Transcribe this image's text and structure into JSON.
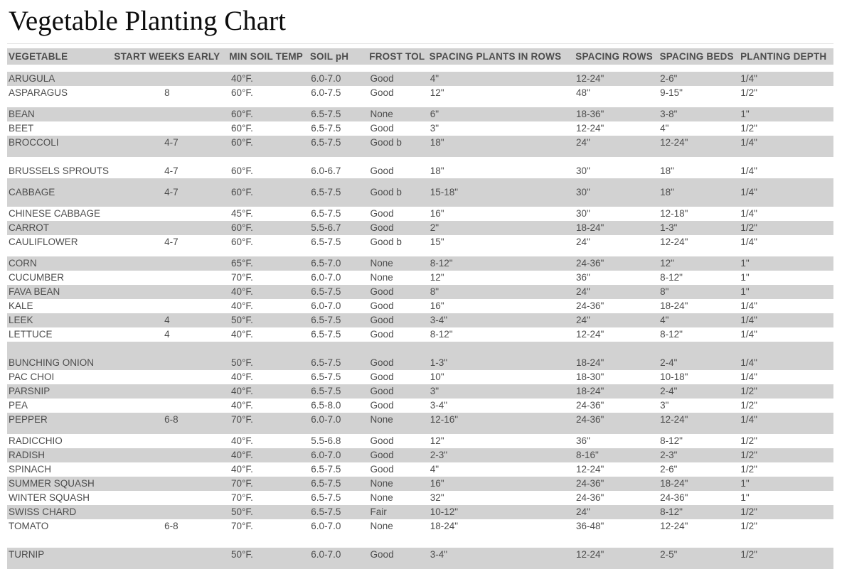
{
  "page_title": "Vegetable Planting Chart",
  "table": {
    "columns": [
      "VEGETABLE",
      "START WEEKS EARLY",
      "MIN SOIL TEMP",
      "SOIL pH",
      "FROST TOL",
      "SPACING PLANTS IN ROWS",
      "SPACING ROWS",
      "SPACING BEDS",
      "PLANTING DEPTH"
    ],
    "rows": [
      {
        "vegetable": "ARUGULA",
        "start_weeks_early": "",
        "min_soil_temp": "40°F.",
        "soil_ph": "6.0-7.0",
        "frost_tol": "Good",
        "spacing_plants_in_rows": "4\"",
        "spacing_rows": "12-24\"",
        "spacing_beds": "2-6\"",
        "planting_depth": "1/4\"",
        "shaded": true
      },
      {
        "vegetable": "ASPARAGUS",
        "start_weeks_early": "8",
        "min_soil_temp": "60°F.",
        "soil_ph": "6.0-7.5",
        "frost_tol": "Good",
        "spacing_plants_in_rows": "12\"",
        "spacing_rows": "48\"",
        "spacing_beds": "9-15\"",
        "planting_depth": "1/2\"",
        "shaded": false
      },
      {
        "vegetable": "BEAN",
        "start_weeks_early": "",
        "min_soil_temp": "60°F.",
        "soil_ph": "6.5-7.5",
        "frost_tol": "None",
        "spacing_plants_in_rows": "6\"",
        "spacing_rows": "18-36\"",
        "spacing_beds": "3-8\"",
        "planting_depth": "1\"",
        "shaded": true
      },
      {
        "vegetable": "BEET",
        "start_weeks_early": "",
        "min_soil_temp": "60°F.",
        "soil_ph": "6.5-7.5",
        "frost_tol": "Good",
        "spacing_plants_in_rows": "3\"",
        "spacing_rows": "12-24\"",
        "spacing_beds": "4\"",
        "planting_depth": "1/2\"",
        "shaded": false
      },
      {
        "vegetable": "BROCCOLI",
        "start_weeks_early": "4-7",
        "min_soil_temp": "60°F.",
        "soil_ph": "6.5-7.5",
        "frost_tol": "Good b",
        "spacing_plants_in_rows": "18\"",
        "spacing_rows": "24\"",
        "spacing_beds": "12-24\"",
        "planting_depth": "1/4\"",
        "shaded": true
      },
      {
        "vegetable": "BRUSSELS SPROUTS",
        "start_weeks_early": "4-7",
        "min_soil_temp": "60°F.",
        "soil_ph": "6.0-6.7",
        "frost_tol": "Good",
        "spacing_plants_in_rows": "18\"",
        "spacing_rows": "30\"",
        "spacing_beds": "18\"",
        "planting_depth": "1/4\"",
        "shaded": false
      },
      {
        "vegetable": "CABBAGE",
        "start_weeks_early": "4-7",
        "min_soil_temp": "60°F.",
        "soil_ph": "6.5-7.5",
        "frost_tol": "Good b",
        "spacing_plants_in_rows": "15-18\"",
        "spacing_rows": "30\"",
        "spacing_beds": "18\"",
        "planting_depth": "1/4\"",
        "shaded": true
      },
      {
        "vegetable": "CHINESE CABBAGE",
        "start_weeks_early": "",
        "min_soil_temp": "45°F.",
        "soil_ph": "6.5-7.5",
        "frost_tol": "Good",
        "spacing_plants_in_rows": "16\"",
        "spacing_rows": "30\"",
        "spacing_beds": "12-18\"",
        "planting_depth": "1/4\"",
        "shaded": false
      },
      {
        "vegetable": "CARROT",
        "start_weeks_early": "",
        "min_soil_temp": "60°F.",
        "soil_ph": "5.5-6.7",
        "frost_tol": "Good",
        "spacing_plants_in_rows": "2\"",
        "spacing_rows": "18-24\"",
        "spacing_beds": "1-3\"",
        "planting_depth": "1/2\"",
        "shaded": true
      },
      {
        "vegetable": "CAULIFLOWER",
        "start_weeks_early": "4-7",
        "min_soil_temp": "60°F.",
        "soil_ph": "6.5-7.5",
        "frost_tol": "Good b",
        "spacing_plants_in_rows": "15\"",
        "spacing_rows": "24\"",
        "spacing_beds": "12-24\"",
        "planting_depth": "1/4\"",
        "shaded": false
      },
      {
        "vegetable": "CORN",
        "start_weeks_early": "",
        "min_soil_temp": "65°F.",
        "soil_ph": "6.5-7.0",
        "frost_tol": "None",
        "spacing_plants_in_rows": "8-12\"",
        "spacing_rows": "24-36\"",
        "spacing_beds": "12\"",
        "planting_depth": "1\"",
        "shaded": true
      },
      {
        "vegetable": "CUCUMBER",
        "start_weeks_early": "",
        "min_soil_temp": "70°F.",
        "soil_ph": "6.0-7.0",
        "frost_tol": "None",
        "spacing_plants_in_rows": "12\"",
        "spacing_rows": "36\"",
        "spacing_beds": "8-12\"",
        "planting_depth": "1\"",
        "shaded": false
      },
      {
        "vegetable": "FAVA BEAN",
        "start_weeks_early": "",
        "min_soil_temp": "40°F.",
        "soil_ph": "6.5-7.5",
        "frost_tol": "Good",
        "spacing_plants_in_rows": "8\"",
        "spacing_rows": "24\"",
        "spacing_beds": "8\"",
        "planting_depth": "1\"",
        "shaded": true
      },
      {
        "vegetable": "KALE",
        "start_weeks_early": "",
        "min_soil_temp": "40°F.",
        "soil_ph": "6.0-7.0",
        "frost_tol": "Good",
        "spacing_plants_in_rows": "16\"",
        "spacing_rows": "24-36\"",
        "spacing_beds": "18-24\"",
        "planting_depth": "1/4\"",
        "shaded": false
      },
      {
        "vegetable": "LEEK",
        "start_weeks_early": "4",
        "min_soil_temp": "50°F.",
        "soil_ph": "6.5-7.5",
        "frost_tol": "Good",
        "spacing_plants_in_rows": "3-4\"",
        "spacing_rows": "24\"",
        "spacing_beds": "4\"",
        "planting_depth": "1/4\"",
        "shaded": true
      },
      {
        "vegetable": "LETTUCE",
        "start_weeks_early": "4",
        "min_soil_temp": "40°F.",
        "soil_ph": "6.5-7.5",
        "frost_tol": "Good",
        "spacing_plants_in_rows": "8-12\"",
        "spacing_rows": "12-24\"",
        "spacing_beds": "8-12\"",
        "planting_depth": "1/4\"",
        "shaded": false
      },
      {
        "vegetable": "BUNCHING ONION",
        "start_weeks_early": "",
        "min_soil_temp": "50°F.",
        "soil_ph": "6.5-7.5",
        "frost_tol": "Good",
        "spacing_plants_in_rows": "1-3\"",
        "spacing_rows": "18-24\"",
        "spacing_beds": "2-4\"",
        "planting_depth": "1/4\"",
        "shaded": true
      },
      {
        "vegetable": "PAC CHOI",
        "start_weeks_early": "",
        "min_soil_temp": "40°F.",
        "soil_ph": "6.5-7.5",
        "frost_tol": "Good",
        "spacing_plants_in_rows": "10\"",
        "spacing_rows": "18-30\"",
        "spacing_beds": "10-18\"",
        "planting_depth": "1/4\"",
        "shaded": false
      },
      {
        "vegetable": "PARSNIP",
        "start_weeks_early": "",
        "min_soil_temp": "40°F.",
        "soil_ph": "6.5-7.5",
        "frost_tol": "Good",
        "spacing_plants_in_rows": "3\"",
        "spacing_rows": "18-24\"",
        "spacing_beds": "2-4\"",
        "planting_depth": "1/2\"",
        "shaded": true
      },
      {
        "vegetable": "PEA",
        "start_weeks_early": "",
        "min_soil_temp": "40°F.",
        "soil_ph": "6.5-8.0",
        "frost_tol": "Good",
        "spacing_plants_in_rows": "3-4\"",
        "spacing_rows": "24-36\"",
        "spacing_beds": "3\"",
        "planting_depth": "1/2\"",
        "shaded": false
      },
      {
        "vegetable": "PEPPER",
        "start_weeks_early": "6-8",
        "min_soil_temp": "70°F.",
        "soil_ph": "6.0-7.0",
        "frost_tol": "None",
        "spacing_plants_in_rows": "12-16\"",
        "spacing_rows": "24-36\"",
        "spacing_beds": "12-24\"",
        "planting_depth": "1/4\"",
        "shaded": true
      },
      {
        "vegetable": "RADICCHIO",
        "start_weeks_early": "",
        "min_soil_temp": "40°F.",
        "soil_ph": "5.5-6.8",
        "frost_tol": "Good",
        "spacing_plants_in_rows": "12\"",
        "spacing_rows": "36\"",
        "spacing_beds": "8-12\"",
        "planting_depth": "1/2\"",
        "shaded": false
      },
      {
        "vegetable": "RADISH",
        "start_weeks_early": "",
        "min_soil_temp": "40°F.",
        "soil_ph": "6.0-7.0",
        "frost_tol": "Good",
        "spacing_plants_in_rows": "2-3\"",
        "spacing_rows": "8-16\"",
        "spacing_beds": "2-3\"",
        "planting_depth": "1/2\"",
        "shaded": true
      },
      {
        "vegetable": "SPINACH",
        "start_weeks_early": "",
        "min_soil_temp": "40°F.",
        "soil_ph": "6.5-7.5",
        "frost_tol": "Good",
        "spacing_plants_in_rows": "4\"",
        "spacing_rows": "12-24\"",
        "spacing_beds": "2-6\"",
        "planting_depth": "1/2\"",
        "shaded": false
      },
      {
        "vegetable": "SUMMER SQUASH",
        "start_weeks_early": "",
        "min_soil_temp": "70°F.",
        "soil_ph": "6.5-7.5",
        "frost_tol": "None",
        "spacing_plants_in_rows": "16\"",
        "spacing_rows": "24-36\"",
        "spacing_beds": "18-24\"",
        "planting_depth": "1\"",
        "shaded": true
      },
      {
        "vegetable": "WINTER SQUASH",
        "start_weeks_early": "",
        "min_soil_temp": "70°F.",
        "soil_ph": "6.5-7.5",
        "frost_tol": "None",
        "spacing_plants_in_rows": "32\"",
        "spacing_rows": "24-36\"",
        "spacing_beds": "24-36\"",
        "planting_depth": "1\"",
        "shaded": false
      },
      {
        "vegetable": "SWISS CHARD",
        "start_weeks_early": "",
        "min_soil_temp": "50°F.",
        "soil_ph": "6.5-7.5",
        "frost_tol": "Fair",
        "spacing_plants_in_rows": "10-12\"",
        "spacing_rows": "24\"",
        "spacing_beds": "8-12\"",
        "planting_depth": "1/2\"",
        "shaded": true
      },
      {
        "vegetable": "TOMATO",
        "start_weeks_early": "6-8",
        "min_soil_temp": "70°F.",
        "soil_ph": "6.0-7.0",
        "frost_tol": "None",
        "spacing_plants_in_rows": "18-24\"",
        "spacing_rows": "36-48\"",
        "spacing_beds": "12-24\"",
        "planting_depth": "1/2\"",
        "shaded": false
      },
      {
        "vegetable": "TURNIP",
        "start_weeks_early": "",
        "min_soil_temp": "50°F.",
        "soil_ph": "6.0-7.0",
        "frost_tol": "Good",
        "spacing_plants_in_rows": "3-4\"",
        "spacing_rows": "12-24\"",
        "spacing_beds": "2-5\"",
        "planting_depth": "1/2\"",
        "shaded": true
      }
    ]
  },
  "colors": {
    "shaded_row": "#d2d2d2",
    "text": "#4d4d4d",
    "header_text": "#555555",
    "title": "#0d0d0d",
    "rule": "#e2e2e2"
  }
}
